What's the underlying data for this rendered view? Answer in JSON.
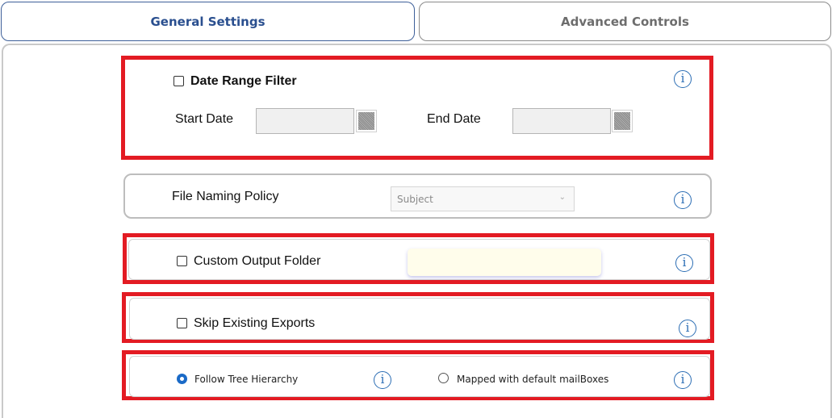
{
  "tabs": {
    "general": "General Settings",
    "advanced": "Advanced Controls"
  },
  "date_filter": {
    "title": "Date Range Filter",
    "start_label": "Start Date",
    "end_label": "End Date",
    "start_value": "",
    "end_value": ""
  },
  "naming": {
    "label": "File Naming Policy",
    "selected": "Subject"
  },
  "output_folder": {
    "label": "Custom Output Folder",
    "value": ""
  },
  "skip": {
    "label": "Skip Existing Exports"
  },
  "hierarchy": {
    "option_tree": "Follow Tree Hierarchy",
    "option_mapped": "Mapped with default mailBoxes"
  },
  "info_glyph": "i",
  "colors": {
    "highlight": "#e31b23",
    "accent": "#2b6db4",
    "active_tab_text": "#2a4f8f"
  }
}
